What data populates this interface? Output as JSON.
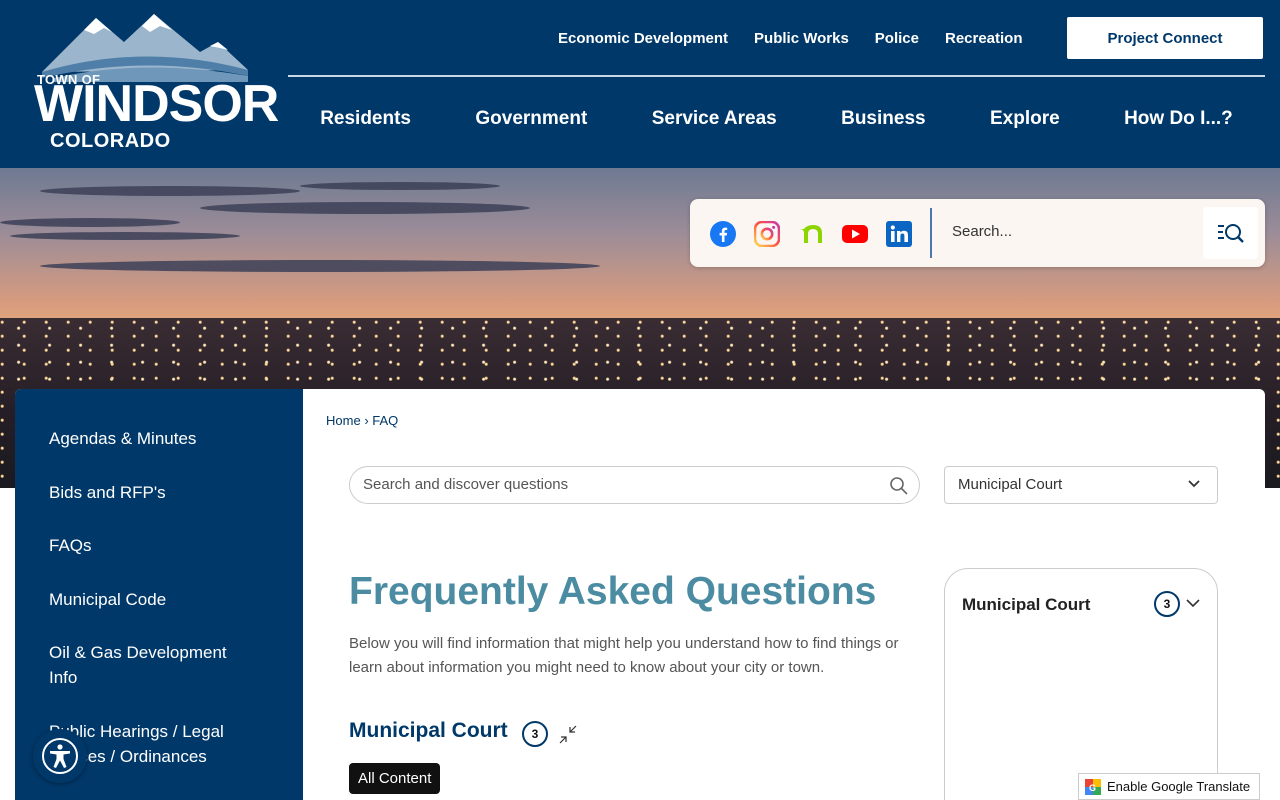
{
  "logo": {
    "line1": "TOWN OF",
    "line2": "WINDSOR",
    "line3": "COLORADO",
    "reg": "®"
  },
  "topnav": [
    "Economic Development",
    "Public Works",
    "Police",
    "Recreation"
  ],
  "project_connect": "Project Connect",
  "mainnav": [
    "Residents",
    "Government",
    "Service Areas",
    "Business",
    "Explore",
    "How Do I...?"
  ],
  "social": [
    "facebook-icon",
    "instagram-icon",
    "nextdoor-icon",
    "youtube-icon",
    "linkedin-icon"
  ],
  "site_search": {
    "placeholder": "Search..."
  },
  "sidebar": {
    "items": [
      "Agendas & Minutes",
      "Bids and RFP's",
      "FAQs",
      "Municipal Code",
      "Oil & Gas Development Info",
      "Public Hearings / Legal Notices / Ordinances"
    ]
  },
  "breadcrumb": {
    "home": "Home",
    "sep": "›",
    "current": "FAQ"
  },
  "faq_search": {
    "placeholder": "Search and discover questions"
  },
  "category_select": {
    "value": "Municipal Court"
  },
  "main": {
    "title": "Frequently Asked Questions",
    "intro": "Below you will find information that might help you understand how to find things or learn about information you might need to know about your city or town.",
    "section": "Municipal Court",
    "section_count": "3",
    "all_content": "All Content"
  },
  "side_card": {
    "title": "Municipal Court",
    "count": "3"
  },
  "google_translate": "Enable Google Translate",
  "colors": {
    "navy": "#003869",
    "teal": "#4b8ca3"
  }
}
